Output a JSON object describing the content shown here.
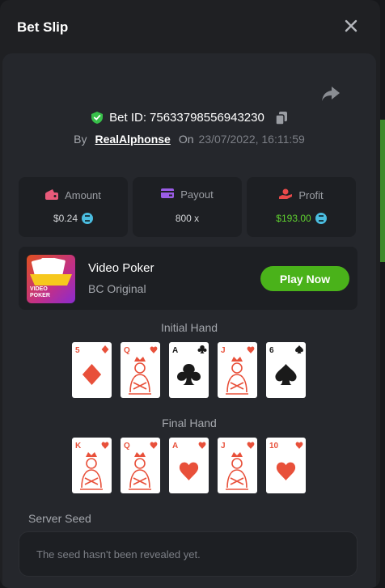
{
  "modal": {
    "title": "Bet Slip"
  },
  "bet": {
    "label": "Bet ID:",
    "id": "75633798556943230",
    "by_label": "By",
    "user": "RealAlphonse",
    "on_label": "On",
    "date": "23/07/2022, 16:11:59"
  },
  "stats": {
    "amount": {
      "label": "Amount",
      "value": "$0.24"
    },
    "payout": {
      "label": "Payout",
      "value": "800 x"
    },
    "profit": {
      "label": "Profit",
      "value": "$193.00"
    }
  },
  "game": {
    "title": "Video Poker",
    "subtitle": "BC Original",
    "thumb_label_1": "VIDEO",
    "thumb_label_2": "POKER",
    "play_label": "Play Now"
  },
  "initial_hand": {
    "label": "Initial Hand",
    "cards": [
      {
        "rank": "5",
        "suit": "diamonds",
        "color": "#e8503a"
      },
      {
        "rank": "Q",
        "suit": "hearts",
        "color": "#e8503a"
      },
      {
        "rank": "A",
        "suit": "clubs",
        "color": "#1a1a1a"
      },
      {
        "rank": "J",
        "suit": "hearts",
        "color": "#e8503a"
      },
      {
        "rank": "6",
        "suit": "spades",
        "color": "#1a1a1a"
      }
    ]
  },
  "final_hand": {
    "label": "Final Hand",
    "cards": [
      {
        "rank": "K",
        "suit": "hearts",
        "color": "#e8503a"
      },
      {
        "rank": "Q",
        "suit": "hearts",
        "color": "#e8503a"
      },
      {
        "rank": "A",
        "suit": "hearts",
        "color": "#e8503a"
      },
      {
        "rank": "J",
        "suit": "hearts",
        "color": "#e8503a"
      },
      {
        "rank": "10",
        "suit": "hearts",
        "color": "#e8503a"
      }
    ]
  },
  "seed": {
    "label": "Server Seed",
    "placeholder": "The seed hasn't been revealed yet."
  },
  "colors": {
    "accent_green": "#4ab21a",
    "profit_green": "#5fd12f",
    "card_red": "#e8503a",
    "card_black": "#1a1a1a"
  },
  "icons": {
    "close": "close-icon",
    "share": "share-icon",
    "shield": "shield-check-icon",
    "copy": "copy-icon",
    "amount": "wallet-in-icon",
    "payout": "card-icon",
    "profit": "hand-coin-icon",
    "coin": "bcd-coin-icon"
  }
}
